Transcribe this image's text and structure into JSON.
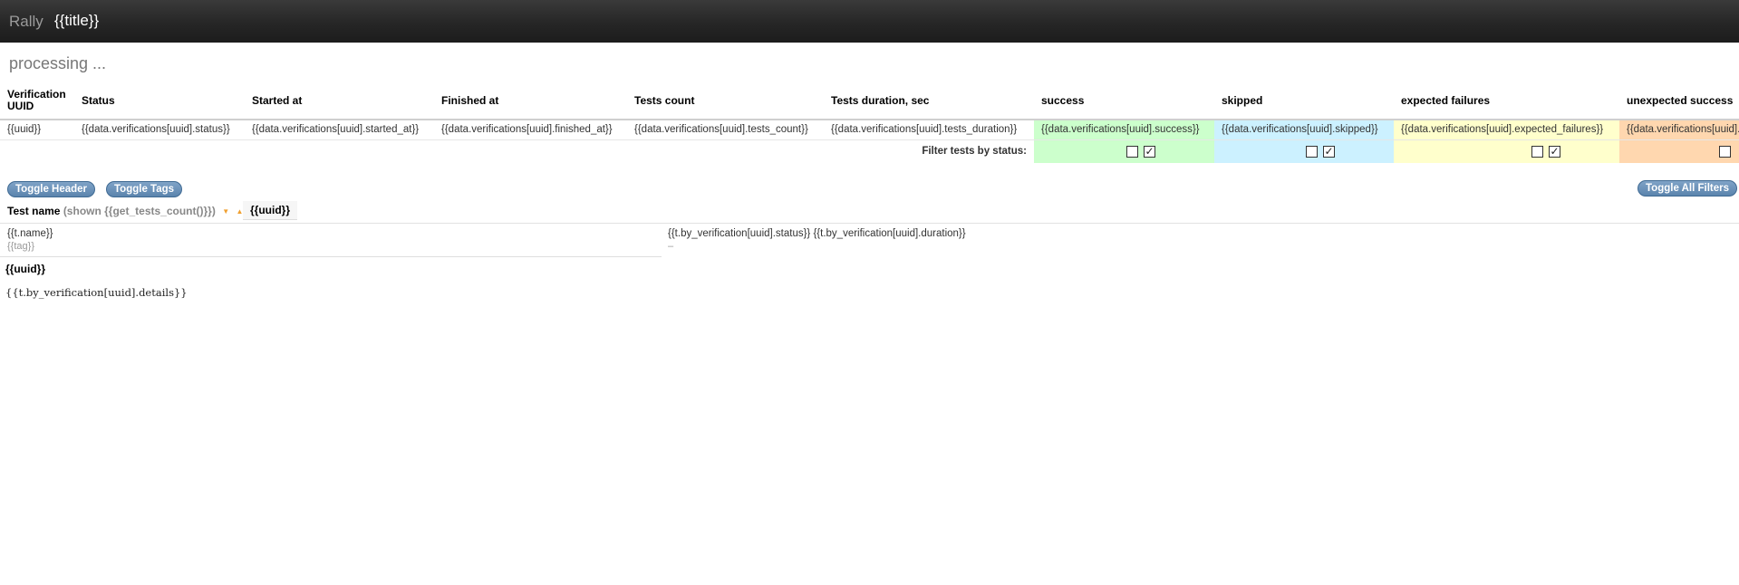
{
  "header": {
    "brand": "Rally",
    "title": "{{title}}"
  },
  "status_text": "processing ...",
  "table": {
    "headers": [
      "Verification UUID",
      "Status",
      "Started at",
      "Finished at",
      "Tests count",
      "Tests duration, sec",
      "success",
      "skipped",
      "expected failures",
      "unexpected success"
    ],
    "row": [
      "{{uuid}}",
      "{{data.verifications[uuid].status}}",
      "{{data.verifications[uuid].started_at}}",
      "{{data.verifications[uuid].finished_at}}",
      "{{data.verifications[uuid].tests_count}}",
      "{{data.verifications[uuid].tests_duration}}",
      "{{data.verifications[uuid].success}}",
      "{{data.verifications[uuid].skipped}}",
      "{{data.verifications[uuid].expected_failures}}",
      "{{data.verifications[uuid].unexpected_success}}"
    ],
    "filter_label": "Filter tests by status:",
    "checked_glyph": "✓"
  },
  "buttons": {
    "toggle_header": "Toggle Header",
    "toggle_tags": "Toggle Tags",
    "toggle_all_filters": "Toggle All Filters"
  },
  "tests": {
    "label": "Test name",
    "shown": "(shown {{get_tests_count()}})",
    "uuid_col": "{{uuid}}",
    "test_name": "{{t.name}}",
    "tag": "{{tag}}",
    "verification_status": "{{t.by_verification[uuid].status}} {{t.by_verification[uuid].duration}}",
    "dash": "–",
    "details_uuid": "{{uuid}}",
    "details": "{{t.by_verification[uuid].details}}"
  },
  "colors": {
    "success": "#ccffcc",
    "skipped": "#ccf1ff",
    "expected_failures": "#ffffcc",
    "unexpected_success": "#ffd7af",
    "button": "#6b93bb"
  }
}
